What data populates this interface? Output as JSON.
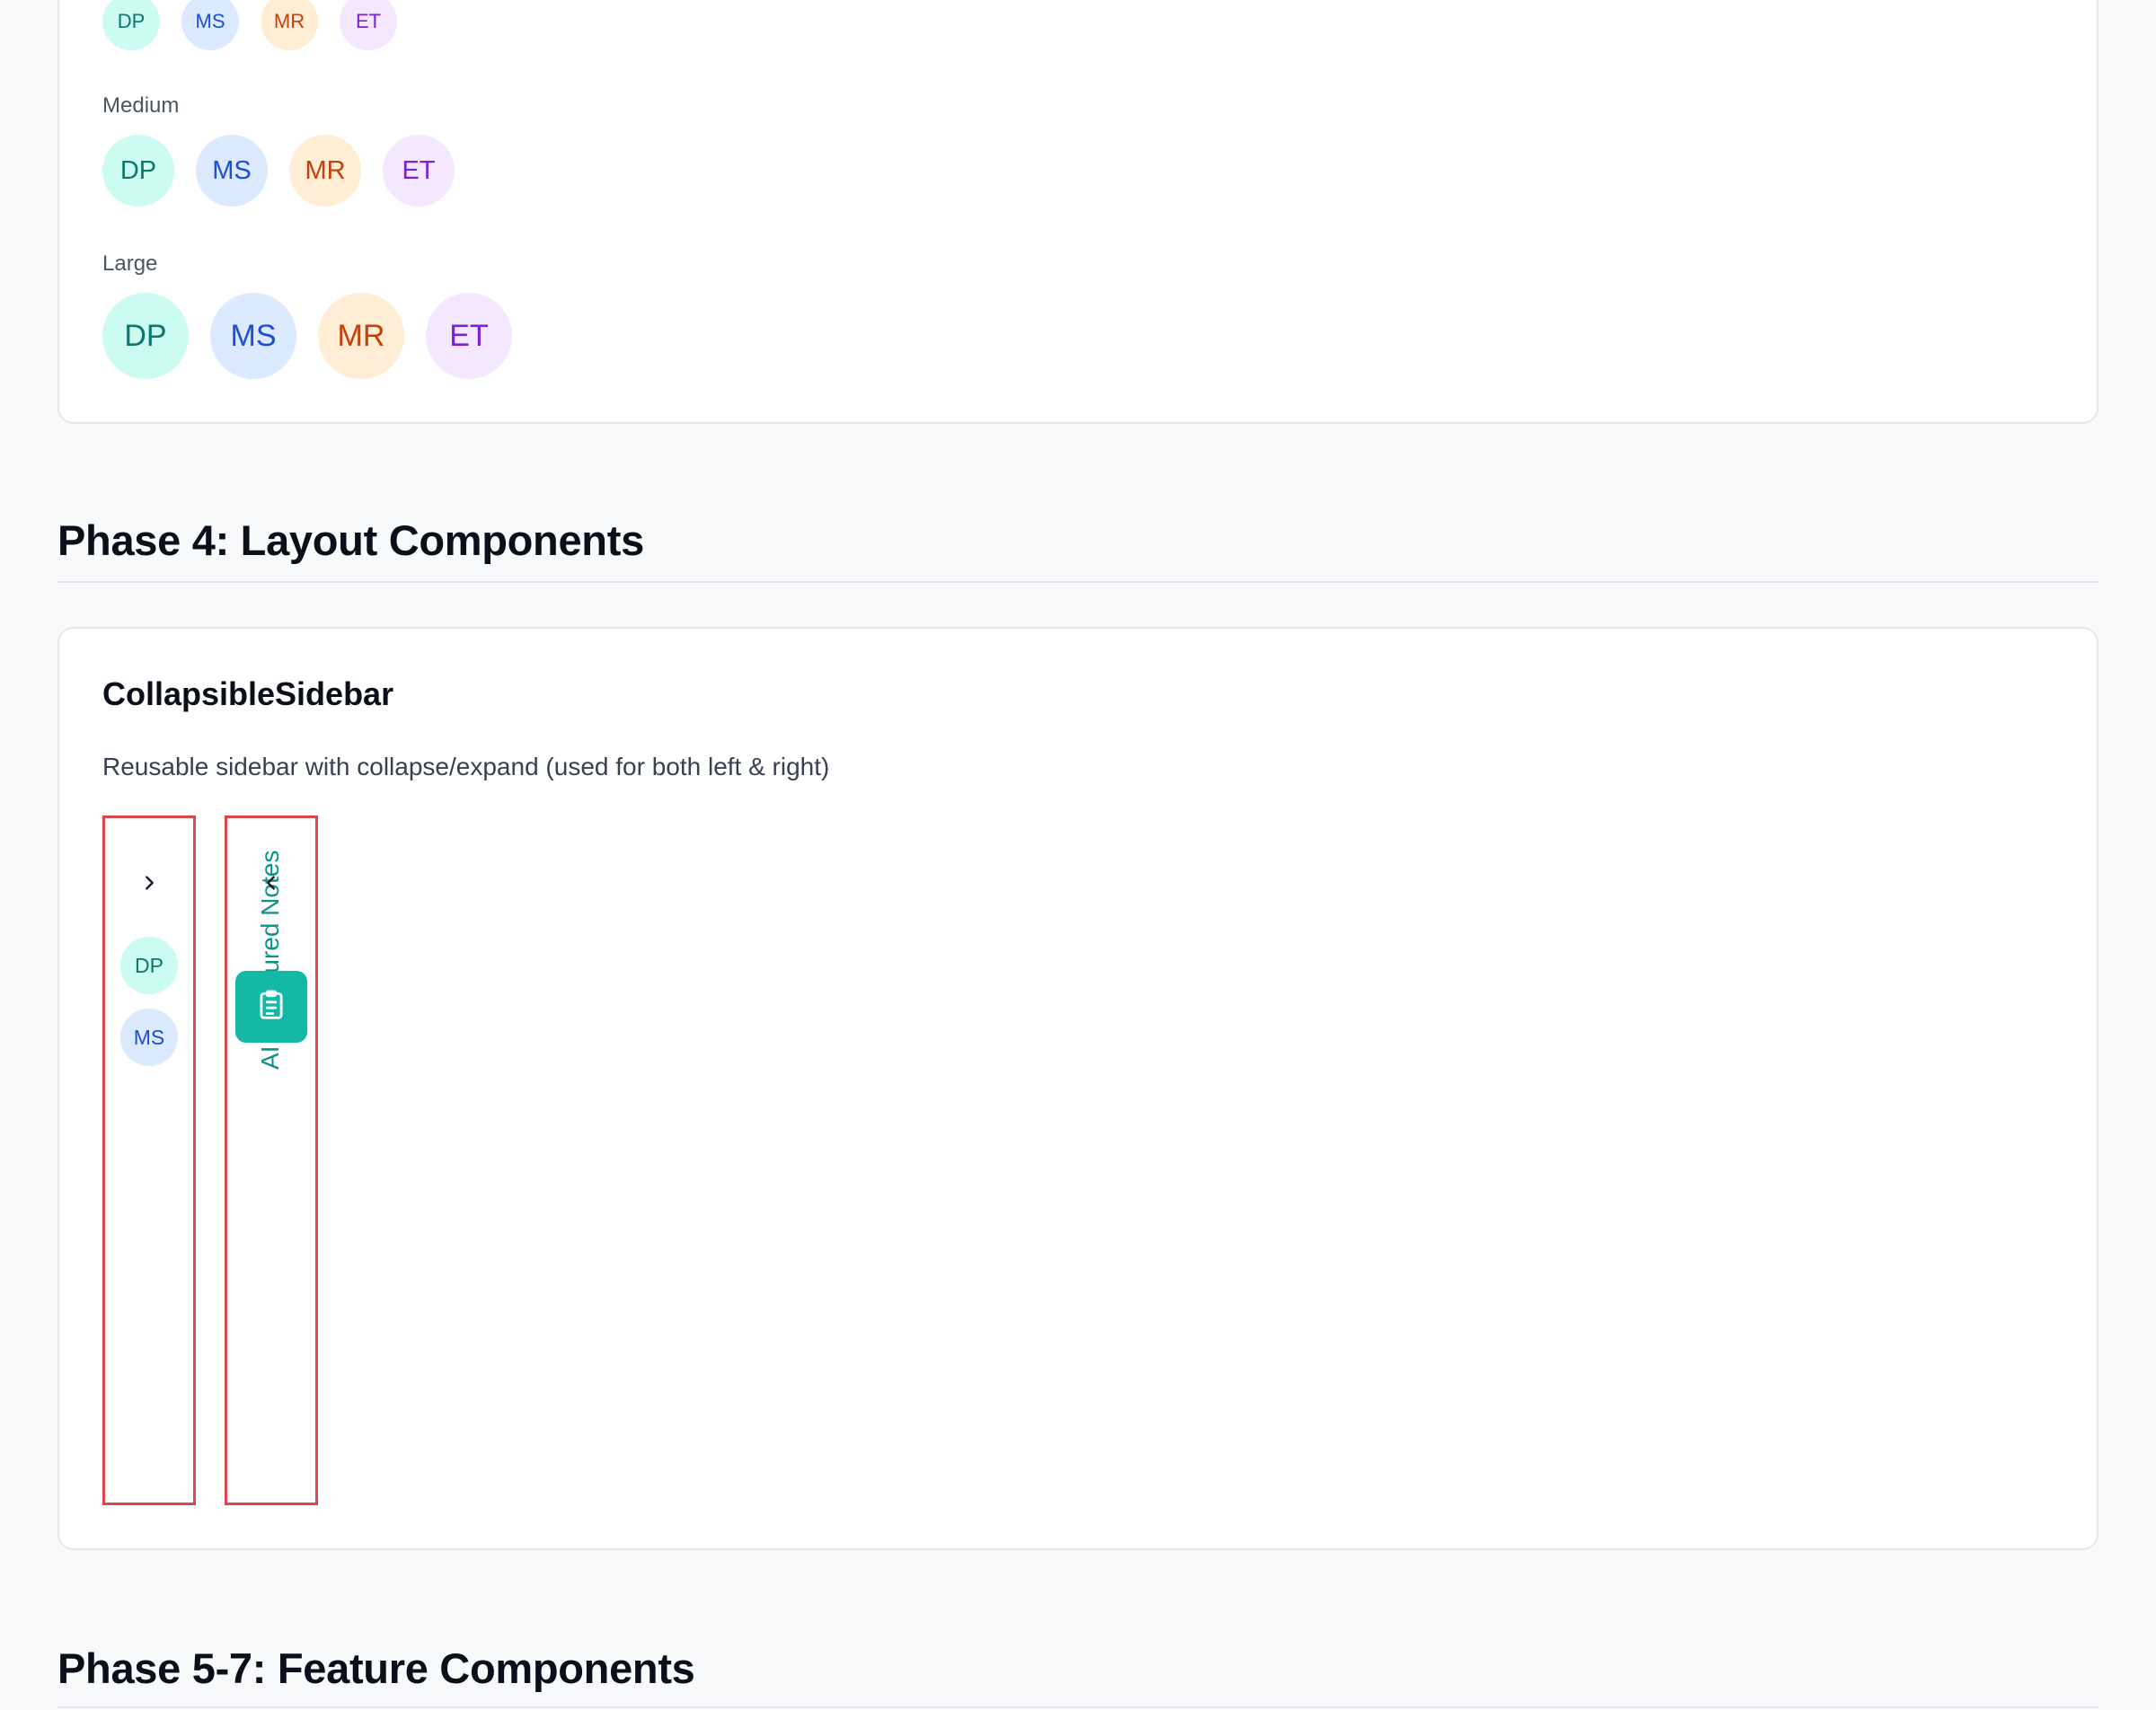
{
  "avatar_sizes": {
    "small": {
      "avatars": [
        "DP",
        "MS",
        "MR",
        "ET"
      ]
    },
    "medium": {
      "label": "Medium",
      "avatars": [
        "DP",
        "MS",
        "MR",
        "ET"
      ]
    },
    "large": {
      "label": "Large",
      "avatars": [
        "DP",
        "MS",
        "MR",
        "ET"
      ]
    }
  },
  "phase4": {
    "title": "Phase 4: Layout Components",
    "component": {
      "name": "CollapsibleSidebar",
      "description": "Reusable sidebar with collapse/expand (used for both left & right)",
      "left_sidebar": {
        "toggle_icon": "chevron-right-icon",
        "avatars": [
          "DP",
          "MS"
        ]
      },
      "right_sidebar": {
        "label": "AI Structured Notes",
        "toggle_icon": "chevron-left-icon",
        "button_icon": "clipboard-icon"
      }
    }
  },
  "phase5": {
    "title": "Phase 5-7: Feature Components"
  },
  "colors": {
    "teal_accent": "#14b8a6",
    "sidebar_border": "#e0474c"
  }
}
